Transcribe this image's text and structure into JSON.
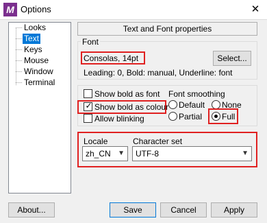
{
  "window": {
    "title": "Options",
    "app_icon_letter": "M"
  },
  "tree": {
    "items": [
      {
        "label": "Looks"
      },
      {
        "label": "Text",
        "selected": true
      },
      {
        "label": "Keys"
      },
      {
        "label": "Mouse"
      },
      {
        "label": "Window"
      },
      {
        "label": "Terminal"
      }
    ]
  },
  "header": "Text and Font properties",
  "font": {
    "group_label": "Font",
    "value": "Consolas, 14pt",
    "select_button": "Select...",
    "info": "Leading: 0, Bold: manual, Underline: font"
  },
  "options": {
    "show_bold_as_font": {
      "label": "Show bold as font",
      "checked": false
    },
    "show_bold_as_colour": {
      "label": "Show bold as colour",
      "checked": true
    },
    "allow_blinking": {
      "label": "Allow blinking",
      "checked": false
    }
  },
  "smoothing": {
    "label": "Font smoothing",
    "default": {
      "label": "Default",
      "selected": false
    },
    "none": {
      "label": "None",
      "selected": false
    },
    "partial": {
      "label": "Partial",
      "selected": false
    },
    "full": {
      "label": "Full",
      "selected": true
    }
  },
  "locale": {
    "label": "Locale",
    "value": "zh_CN"
  },
  "charset": {
    "label": "Character set",
    "value": "UTF-8"
  },
  "buttons": {
    "about": "About...",
    "save": "Save",
    "cancel": "Cancel",
    "apply": "Apply"
  },
  "colors": {
    "highlight": "#e02020",
    "selection": "#0078d7",
    "app_icon": "#7b2f8e"
  }
}
